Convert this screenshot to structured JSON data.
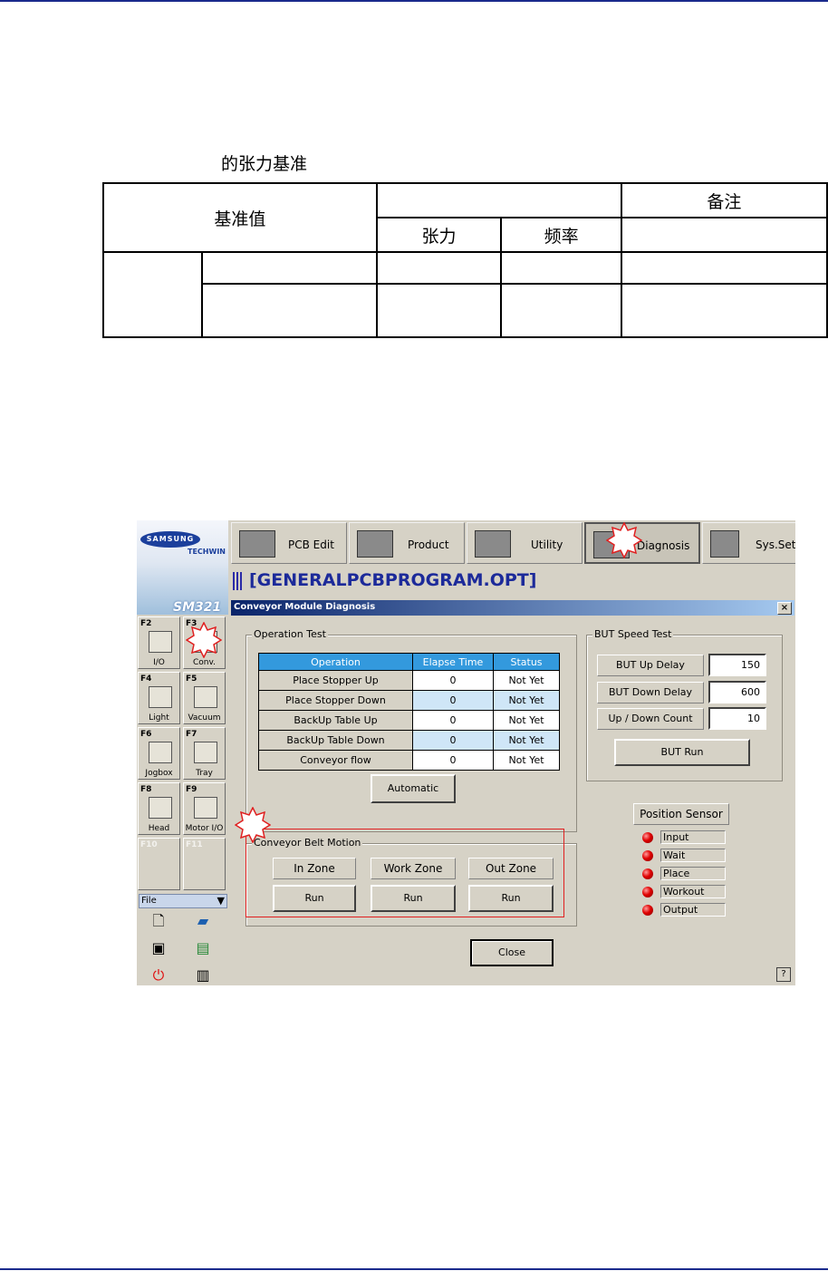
{
  "doc": {
    "caption": "的张力基准"
  },
  "tension_table": {
    "col1_header": "基准值",
    "col2_header": "",
    "col3_header": "备注",
    "sub_tension": "张力",
    "sub_frequency": "频率"
  },
  "app": {
    "brand": "SAMSUNG",
    "brand_sub": "TECHWIN",
    "model": "SM321",
    "toolbar": [
      {
        "label": "PCB Edit",
        "icon": "pcb-edit-icon"
      },
      {
        "label": "Product",
        "icon": "product-icon"
      },
      {
        "label": "Utility",
        "icon": "utility-icon"
      },
      {
        "label": "Diagnosis",
        "icon": "diagnosis-icon"
      },
      {
        "label": "Sys.Set",
        "icon": "sys-set-icon"
      }
    ],
    "program_title": "[GENERALPCBPROGRAM.OPT]",
    "fkeys": [
      {
        "key": "F2",
        "label": "I/O"
      },
      {
        "key": "F3",
        "label": "Conv."
      },
      {
        "key": "F4",
        "label": "Light"
      },
      {
        "key": "F5",
        "label": "Vacuum"
      },
      {
        "key": "F6",
        "label": "Jogbox"
      },
      {
        "key": "F7",
        "label": "Tray"
      },
      {
        "key": "F8",
        "label": "Head"
      },
      {
        "key": "F9",
        "label": "Motor I/O"
      },
      {
        "key": "F10",
        "label": ""
      },
      {
        "key": "F11",
        "label": ""
      }
    ],
    "file_menu": "File"
  },
  "dialog": {
    "title": "Conveyor Module Diagnosis",
    "close_x": "×",
    "operation_test": {
      "group_title": "Operation Test",
      "headers": [
        "Operation",
        "Elapse Time",
        "Status"
      ],
      "rows": [
        {
          "operation": "Place Stopper Up",
          "elapse": "0",
          "status": "Not Yet"
        },
        {
          "operation": "Place Stopper Down",
          "elapse": "0",
          "status": "Not Yet"
        },
        {
          "operation": "BackUp Table Up",
          "elapse": "0",
          "status": "Not Yet"
        },
        {
          "operation": "BackUp Table Down",
          "elapse": "0",
          "status": "Not Yet"
        },
        {
          "operation": "Conveyor flow",
          "elapse": "0",
          "status": "Not Yet"
        }
      ],
      "automatic": "Automatic"
    },
    "but_speed": {
      "group_title": "BUT Speed Test",
      "up_delay_label": "BUT Up Delay",
      "up_delay_value": "150",
      "down_delay_label": "BUT Down Delay",
      "down_delay_value": "600",
      "count_label": "Up / Down Count",
      "count_value": "10",
      "run": "BUT Run"
    },
    "position_sensor": {
      "title": "Position Sensor",
      "items": [
        "Input",
        "Wait",
        "Place",
        "Workout",
        "Output"
      ],
      "led_color": "#e00000"
    },
    "belt_motion": {
      "group_title": "Conveyor Belt Motion",
      "zones": [
        "In Zone",
        "Work Zone",
        "Out Zone"
      ],
      "run": "Run"
    },
    "close": "Close",
    "help": "?"
  },
  "colors": {
    "accent": "#3399dd",
    "rule": "#1a2a8c",
    "highlight": "#e02020"
  }
}
